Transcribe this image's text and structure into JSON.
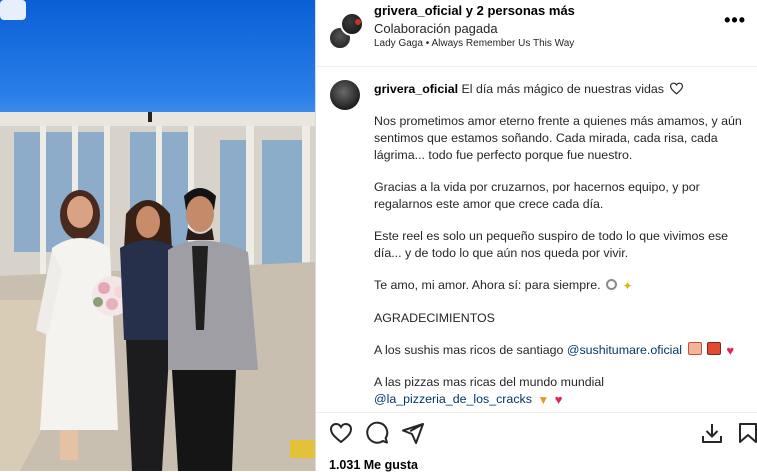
{
  "post": {
    "author": "grivera_oficial",
    "coauthors": "y 2 personas más",
    "subtitle": "Colaboración pagada",
    "music_artist": "Lady Gaga",
    "music_separator": "•",
    "music_title": "Always Remember Us This Way"
  },
  "caption": {
    "author": "grivera_oficial",
    "first_line": "El día más mágico de nuestras vidas",
    "p1": "Nos prometimos amor eterno frente a quienes más amamos, y aún sentimos que estamos soñando. Cada mirada, cada risa, cada lágrima... todo fue perfecto porque fue nuestro.",
    "p2": "Gracias a la vida por cruzarnos, por hacernos equipo, y por regalarnos este amor que crece cada día.",
    "p3": "Este reel es solo un pequeño suspiro de todo lo que vivimos ese día... y de todo lo que aún nos queda por vivir.",
    "p4": "Te amo, mi amor. Ahora sí: para siempre.",
    "p5": "AGRADECIMIENTOS",
    "p6_text": "A los sushis mas ricos de santiago",
    "p6_link": "@sushitumare.oficial",
    "p7_text": "A las pizzas mas ricas del mundo mundial",
    "p7_link": "@la_pizzeria_de_los_cracks"
  },
  "footer": {
    "likes": "1.031 Me gusta"
  },
  "icons": {
    "like": "heart-outline-icon",
    "comment": "comment-icon",
    "share": "send-icon",
    "download": "download-icon",
    "save": "bookmark-icon",
    "more": "more-horizontal-icon"
  },
  "colors": {
    "link": "#00376b",
    "heart_red": "#e0245e",
    "sky": "#0a5fd6"
  }
}
